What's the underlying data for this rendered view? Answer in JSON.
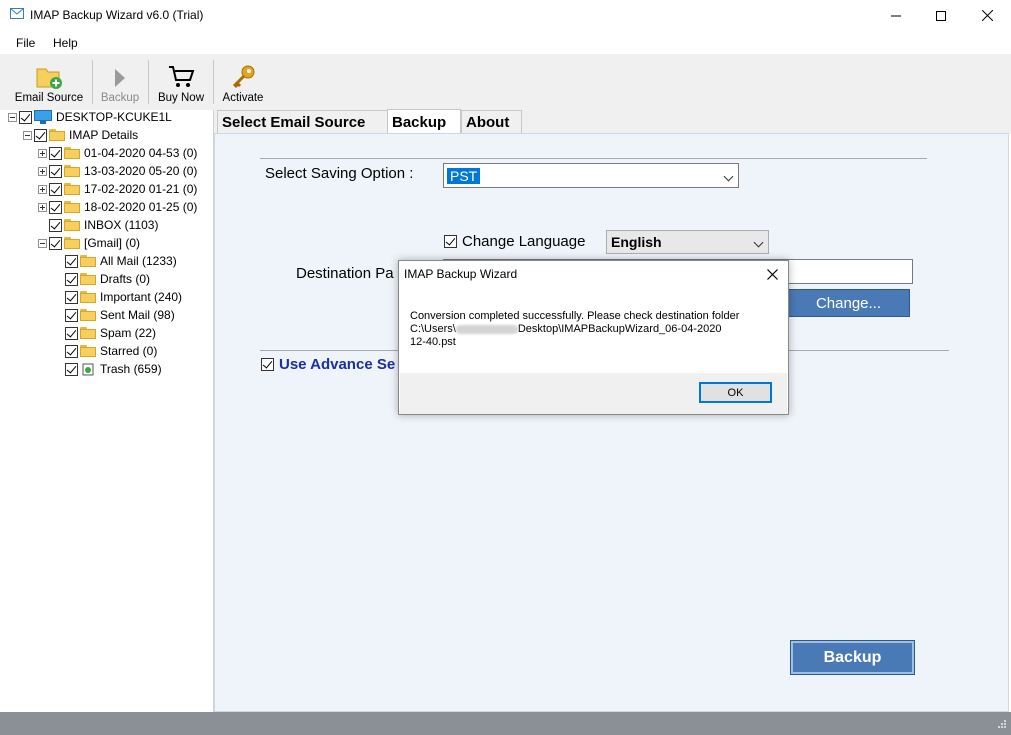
{
  "window": {
    "title": "IMAP Backup Wizard v6.0 (Trial)"
  },
  "menu": [
    "File",
    "Help"
  ],
  "toolbar": {
    "email_source": "Email Source",
    "backup": "Backup",
    "buy_now": "Buy Now",
    "activate": "Activate"
  },
  "tree": {
    "root": "DESKTOP-KCUKE1L",
    "imap": "IMAP Details",
    "items": [
      "01-04-2020 04-53 (0)",
      "13-03-2020 05-20 (0)",
      "17-02-2020 01-21 (0)",
      "18-02-2020 01-25 (0)",
      "INBOX (1103)",
      "[Gmail] (0)"
    ],
    "gmail_children": [
      {
        "label": "All Mail (1233)",
        "icon": "folder-icon"
      },
      {
        "label": "Drafts (0)",
        "icon": "drafts-icon"
      },
      {
        "label": "Important (240)",
        "icon": "folder-icon"
      },
      {
        "label": "Sent Mail (98)",
        "icon": "sent-icon"
      },
      {
        "label": "Spam (22)",
        "icon": "folder-icon"
      },
      {
        "label": "Starred (0)",
        "icon": "folder-icon"
      },
      {
        "label": "Trash (659)",
        "icon": "trash-icon"
      }
    ]
  },
  "tabs": [
    "Select Email Source",
    "Backup",
    "About"
  ],
  "backup": {
    "saving_label": "Select Saving Option :",
    "saving_value": "PST",
    "change_language_label": "Change Language",
    "language_value": "English",
    "destination_label": "Destination Pa",
    "change_button": "Change...",
    "advance_label": "Use Advance Se",
    "backup_button": "Backup"
  },
  "dialog": {
    "title": "IMAP Backup Wizard",
    "message_line1": "Conversion completed successfully. Please check destination folder",
    "message_line2a": "C:\\Users\\",
    "message_line2b": "Desktop\\IMAPBackupWizard_06-04-2020",
    "message_line3": "12-40.pst",
    "ok": "OK"
  },
  "colors": {
    "accent_button": "#4a7ab5",
    "content_bg": "#eef4fa",
    "statusbar": "#8a9095"
  }
}
